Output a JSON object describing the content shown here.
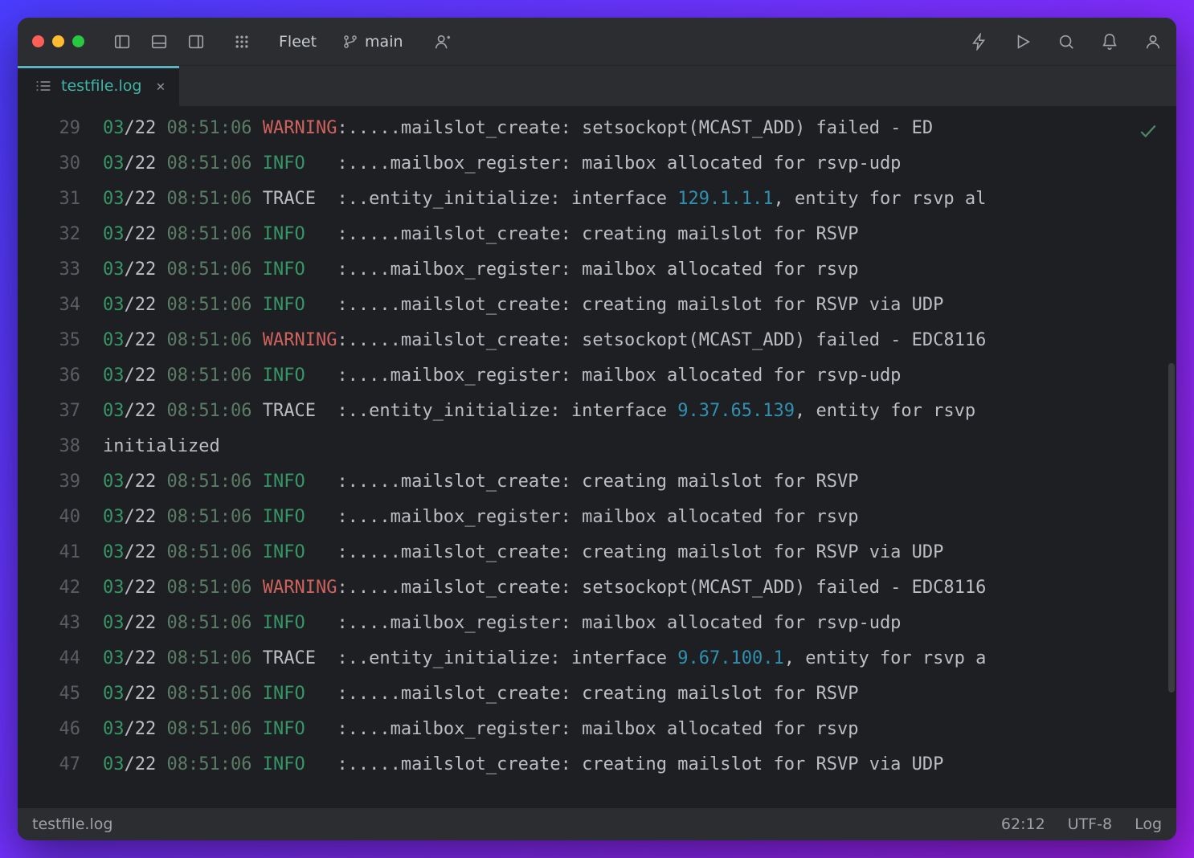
{
  "app": {
    "name": "Fleet"
  },
  "branch": "main",
  "tab": {
    "title": "testfile.log"
  },
  "status": {
    "path": "testfile.log",
    "caret": "62:12",
    "encoding": "UTF-8",
    "lang": "Log"
  },
  "editor": {
    "lines": [
      {
        "n": 29,
        "date": "03/22",
        "time": "08:51:06",
        "level": "WARNING",
        "msg": ":.....mailslot_create: setsockopt(MCAST_ADD) failed - ED"
      },
      {
        "n": 30,
        "date": "03/22",
        "time": "08:51:06",
        "level": "INFO",
        "msg": ":....mailbox_register: mailbox allocated for rsvp-udp"
      },
      {
        "n": 31,
        "date": "03/22",
        "time": "08:51:06",
        "level": "TRACE",
        "msg": ":..entity_initialize: interface ",
        "ip": "129.1.1.1",
        "tail": ", entity for rsvp al"
      },
      {
        "n": 32,
        "date": "03/22",
        "time": "08:51:06",
        "level": "INFO",
        "msg": ":.....mailslot_create: creating mailslot for RSVP"
      },
      {
        "n": 33,
        "date": "03/22",
        "time": "08:51:06",
        "level": "INFO",
        "msg": ":....mailbox_register: mailbox allocated for rsvp"
      },
      {
        "n": 34,
        "date": "03/22",
        "time": "08:51:06",
        "level": "INFO",
        "msg": ":.....mailslot_create: creating mailslot for RSVP via UDP"
      },
      {
        "n": 35,
        "date": "03/22",
        "time": "08:51:06",
        "level": "WARNING",
        "msg": ":.....mailslot_create: setsockopt(MCAST_ADD) failed - EDC8116"
      },
      {
        "n": 36,
        "date": "03/22",
        "time": "08:51:06",
        "level": "INFO",
        "msg": ":....mailbox_register: mailbox allocated for rsvp-udp"
      },
      {
        "n": 37,
        "date": "03/22",
        "time": "08:51:06",
        "level": "TRACE",
        "msg": ":..entity_initialize: interface ",
        "ip": "9.37.65.139",
        "tail": ", entity for rsvp "
      },
      {
        "n": 38,
        "raw": "initialized"
      },
      {
        "n": 39,
        "date": "03/22",
        "time": "08:51:06",
        "level": "INFO",
        "msg": ":.....mailslot_create: creating mailslot for RSVP"
      },
      {
        "n": 40,
        "date": "03/22",
        "time": "08:51:06",
        "level": "INFO",
        "msg": ":....mailbox_register: mailbox allocated for rsvp"
      },
      {
        "n": 41,
        "date": "03/22",
        "time": "08:51:06",
        "level": "INFO",
        "msg": ":.....mailslot_create: creating mailslot for RSVP via UDP"
      },
      {
        "n": 42,
        "date": "03/22",
        "time": "08:51:06",
        "level": "WARNING",
        "msg": ":.....mailslot_create: setsockopt(MCAST_ADD) failed - EDC8116"
      },
      {
        "n": 43,
        "date": "03/22",
        "time": "08:51:06",
        "level": "INFO",
        "msg": ":....mailbox_register: mailbox allocated for rsvp-udp"
      },
      {
        "n": 44,
        "date": "03/22",
        "time": "08:51:06",
        "level": "TRACE",
        "msg": ":..entity_initialize: interface ",
        "ip": "9.67.100.1",
        "tail": ", entity for rsvp a"
      },
      {
        "n": 45,
        "date": "03/22",
        "time": "08:51:06",
        "level": "INFO",
        "msg": ":.....mailslot_create: creating mailslot for RSVP"
      },
      {
        "n": 46,
        "date": "03/22",
        "time": "08:51:06",
        "level": "INFO",
        "msg": ":....mailbox_register: mailbox allocated for rsvp"
      },
      {
        "n": 47,
        "date": "03/22",
        "time": "08:51:06",
        "level": "INFO",
        "msg": ":.....mailslot_create: creating mailslot for RSVP via UDP"
      }
    ]
  }
}
